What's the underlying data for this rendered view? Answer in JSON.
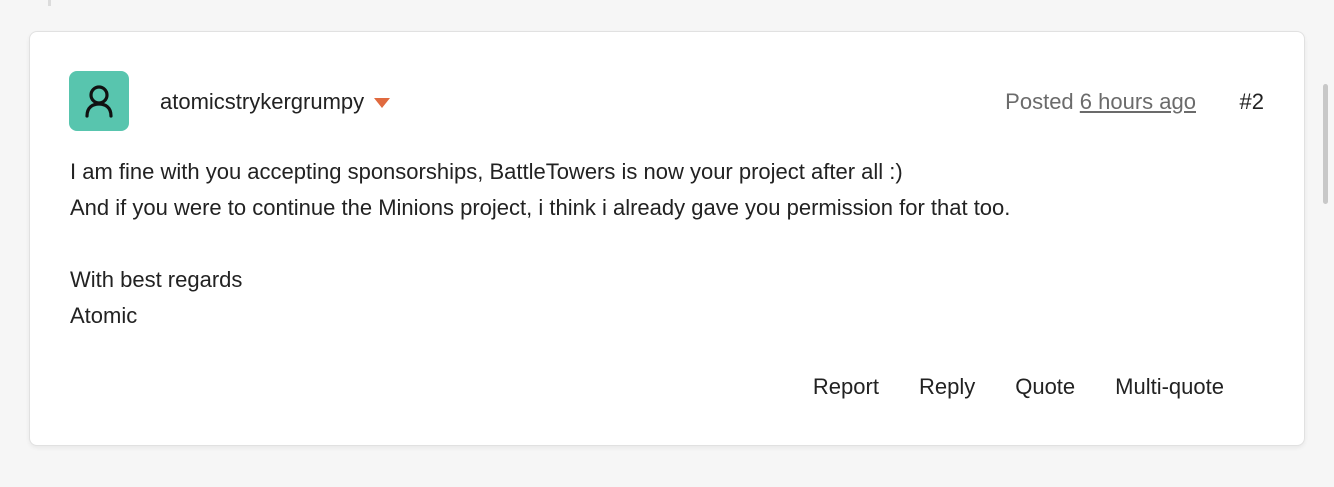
{
  "post": {
    "author": "atomicstrykergrumpy",
    "posted_prefix": "Posted",
    "posted_time": "6 hours ago",
    "number": "#2",
    "avatar_color": "#58c5ae",
    "avatar_icon": "user-icon",
    "body": {
      "line1": "I am fine with you accepting sponsorships, BattleTowers is now your project after all :)",
      "line2": "And if you were to continue the Minions project, i think i already gave you permission for that too.",
      "line3": "With best regards",
      "line4": "Atomic"
    },
    "actions": {
      "report": "Report",
      "reply": "Reply",
      "quote": "Quote",
      "multiquote": "Multi-quote"
    }
  }
}
